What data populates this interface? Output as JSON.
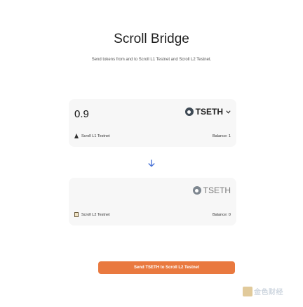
{
  "header": {
    "title": "Scroll Bridge",
    "subtitle": "Send tokens from and to Scroll L1 Testnet and Scroll L2 Testnet."
  },
  "from_card": {
    "amount": "0.9",
    "token": "TSETH",
    "network": "Scroll L1 Testnet",
    "balance": "Balance: 1",
    "token_icon": "token-icon",
    "network_icon": "eth-icon"
  },
  "to_card": {
    "token": "TSETH",
    "network": "Scroll L2 Testnet",
    "balance": "Balance: 0",
    "token_icon": "token-icon",
    "network_icon": "scroll-icon"
  },
  "swap_icon": "arrow-down-icon",
  "send_button": {
    "label": "Send TSETH to Scroll L2 Testnet"
  },
  "watermark": {
    "text": "金色财经"
  },
  "colors": {
    "accent": "#e9793f",
    "card_bg": "#f7f7f7",
    "arrow": "#4a73d6"
  }
}
